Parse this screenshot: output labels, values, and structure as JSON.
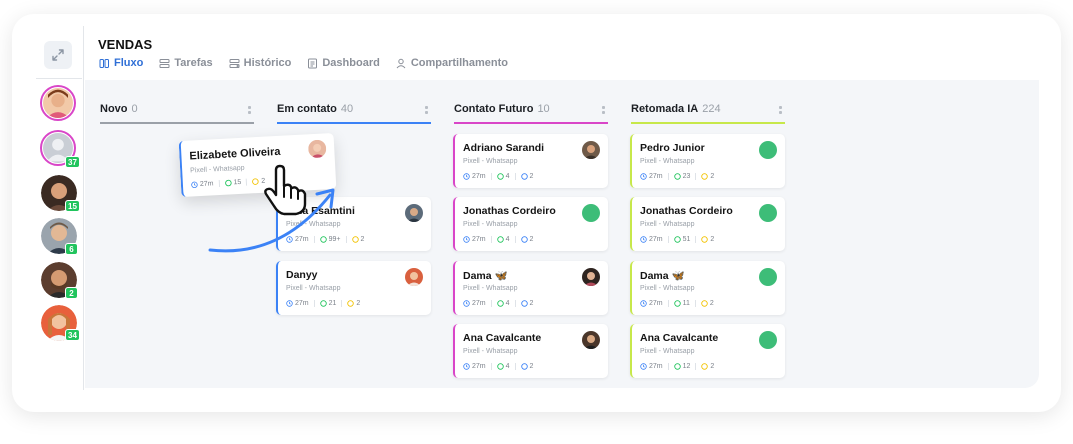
{
  "header": {
    "title": "VENDAS"
  },
  "tabs": [
    {
      "label": "Fluxo",
      "icon": "columns-icon",
      "active": true
    },
    {
      "label": "Tarefas",
      "icon": "tasks-icon",
      "active": false
    },
    {
      "label": "Histórico",
      "icon": "history-icon",
      "active": false
    },
    {
      "label": "Dashboard",
      "icon": "dashboard-icon",
      "active": false
    },
    {
      "label": "Compartilhamento",
      "icon": "share-icon",
      "active": false
    }
  ],
  "rail": {
    "badges": [
      "37",
      "15",
      "6",
      "2",
      "34"
    ]
  },
  "columns": [
    {
      "title": "Novo",
      "count": "0",
      "color": "#9aa0a8"
    },
    {
      "title": "Em contato",
      "count": "40",
      "color": "#3b82f6"
    },
    {
      "title": "Contato Futuro",
      "count": "10",
      "color": "#d946c8"
    },
    {
      "title": "Retomada IA",
      "count": "224",
      "color": "#c7e84a"
    }
  ],
  "drag_card": {
    "name": "Elizabete Oliveira",
    "source": "Pixell - Whatsapp",
    "time": "27m",
    "msgs": "15",
    "tags": "2"
  },
  "cards": {
    "em_contato": [
      {
        "name": "Ema Esamtini",
        "source": "Pixell - Whatsapp",
        "time": "27m",
        "msgs": "99+",
        "tags": "2"
      },
      {
        "name": "Danyy",
        "source": "Pixell - Whatsapp",
        "time": "27m",
        "msgs": "21",
        "tags": "2"
      }
    ],
    "contato_futuro": [
      {
        "name": "Adriano Sarandi",
        "source": "Pixell - Whatsapp",
        "time": "27m",
        "msgs": "4",
        "tags": "2"
      },
      {
        "name": "Jonathas Cordeiro",
        "source": "Pixell - Whatsapp",
        "time": "27m",
        "msgs": "4",
        "tags": "2"
      },
      {
        "name": "Dama 🦋",
        "source": "Pixell - Whatsapp",
        "time": "27m",
        "msgs": "4",
        "tags": "2"
      },
      {
        "name": "Ana Cavalcante",
        "source": "Pixell - Whatsapp",
        "time": "27m",
        "msgs": "4",
        "tags": "2"
      }
    ],
    "retomada_ia": [
      {
        "name": "Pedro Junior",
        "source": "Pixell - Whatsapp",
        "time": "27m",
        "msgs": "23",
        "tags": "2"
      },
      {
        "name": "Jonathas Cordeiro",
        "source": "Pixell - Whatsapp",
        "time": "27m",
        "msgs": "51",
        "tags": "2"
      },
      {
        "name": "Dama 🦋",
        "source": "Pixell - Whatsapp",
        "time": "27m",
        "msgs": "11",
        "tags": "2"
      },
      {
        "name": "Ana Cavalcante",
        "source": "Pixell - Whatsapp",
        "time": "27m",
        "msgs": "12",
        "tags": "2"
      }
    ]
  },
  "colors": {
    "accent": "#2f6fd6",
    "online": "#3dbd78",
    "badge": "#21c45d"
  }
}
